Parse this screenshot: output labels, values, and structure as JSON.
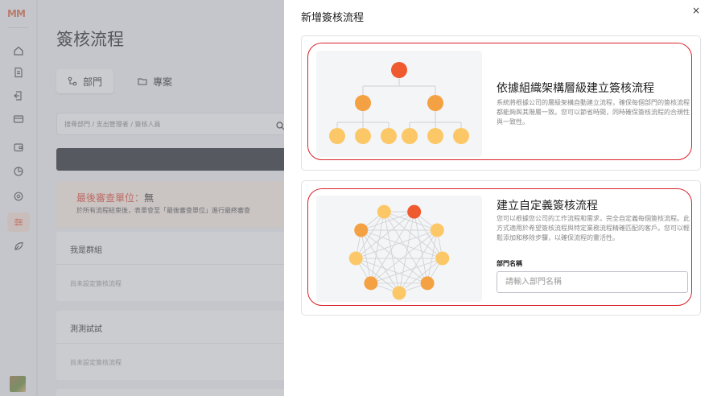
{
  "app": {
    "logo_text": "MM"
  },
  "rail": {
    "icons": [
      "home-icon",
      "document-icon",
      "return-icon",
      "card-icon",
      "wallet-icon",
      "chart-icon",
      "settings-icon",
      "workflow-icon",
      "leaf-icon"
    ],
    "active_index": 7,
    "accent": "#e9714f"
  },
  "page": {
    "title": "簽核流程",
    "tabs": [
      {
        "label": "部門",
        "icon": "org-icon",
        "active": true
      },
      {
        "label": "專案",
        "icon": "folder-icon",
        "active": false
      }
    ],
    "search_placeholder": "搜尋部門 / 支出管理者 / 簽核人員",
    "final_reviewer": {
      "label": "最後審查單位：",
      "value": "無",
      "description": "於所有流程結束後，表單會至「最後審查單位」進行最終審查"
    },
    "groups": [
      {
        "name": "我是群組",
        "empty_text": "尚未設定簽核流程"
      },
      {
        "name": "測測試試",
        "empty_text": "尚未設定簽核流程"
      }
    ]
  },
  "modal": {
    "title": "新增簽核流程",
    "close_label": "×",
    "options": [
      {
        "title": "依據組織架構層級建立簽核流程",
        "description": "系統將根據公司的層級架構自動建立流程，確保每個部門的簽核流程都能夠與其階層一致。您可以節省時間，同時確保簽核流程的合規性與一致性。"
      },
      {
        "title": "建立自定義簽核流程",
        "description": "您可以根據您公司的工作流程和需求，完全自定義每個簽核流程。此方式適用於希望簽核流程與特定業務流程精確匹配的客戶。您可以輕鬆添加和移除步驟，以確保流程的靈活性。",
        "field_label": "部門名稱",
        "field_placeholder": "請輸入部門名稱",
        "field_value": ""
      }
    ],
    "highlight_color": "#d8232a",
    "node_colors": {
      "top": "#ef5a2f",
      "mid": "#f4a143",
      "low": "#fcc867"
    }
  }
}
